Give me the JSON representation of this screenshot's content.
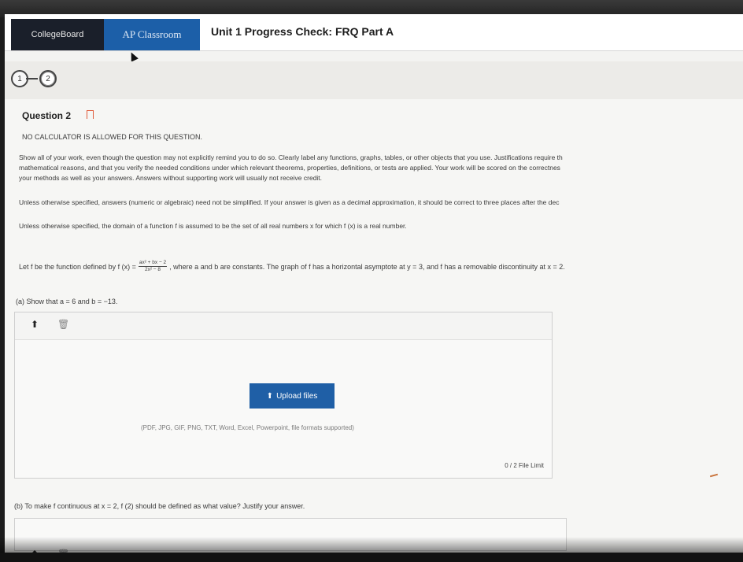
{
  "header": {
    "logo_text": "CollegeBoard",
    "app_name": "AP Classroom",
    "page_title": "Unit 1 Progress Check: FRQ Part A"
  },
  "nav": {
    "questions": [
      "1",
      "2"
    ],
    "active_question": "2"
  },
  "question": {
    "heading": "Question 2",
    "calculator_notice": "NO CALCULATOR IS ALLOWED FOR THIS QUESTION.",
    "instructions": [
      "Show all of your work, even though the question may not explicitly remind you to do so. Clearly label any functions, graphs, tables, or other objects that you use. Justifications require th",
      "mathematical reasons, and that you verify the needed conditions under which relevant theorems, properties, definitions, or tests are applied. Your work will be scored on the correctnes",
      "your methods as well as your answers. Answers without supporting work will usually not receive credit."
    ],
    "simplify_note": "Unless otherwise specified, answers (numeric or algebraic) need not be simplified. If your answer is given as a decimal approximation, it should be correct to three places after the dec",
    "domain_note": "Unless otherwise specified, the domain of a function f is assumed to be the set of all real numbers x for which f (x) is a real number.",
    "prompt_prefix": "Let f be the function defined by f (x) =",
    "fraction_num": "ax² + bx − 2",
    "fraction_den": "2x² − 8",
    "prompt_suffix": ", where a and b are constants. The graph of f has a horizontal asymptote at y = 3, and f has a removable discontinuity at x = 2.",
    "part_a": "(a) Show that a = 6 and b = −13.",
    "part_b": "(b) To make f continuous at x = 2, f (2) should be defined as what value? Justify your answer."
  },
  "upload": {
    "button_label": "Upload files",
    "formats_note": "(PDF, JPG, GIF, PNG, TXT, Word, Excel, Powerpoint, file formats supported)",
    "file_limit": "0 / 2 File Limit"
  },
  "icons": {
    "upload": "upload-arrow-icon",
    "trash": "trash-icon",
    "bookmark": "bookmark-icon",
    "cursor": "mouse-cursor-icon"
  },
  "colors": {
    "ap_blue": "#1c5fa8",
    "upload_button": "#1f5fa6",
    "bookmark_orange": "#e05a3a"
  }
}
